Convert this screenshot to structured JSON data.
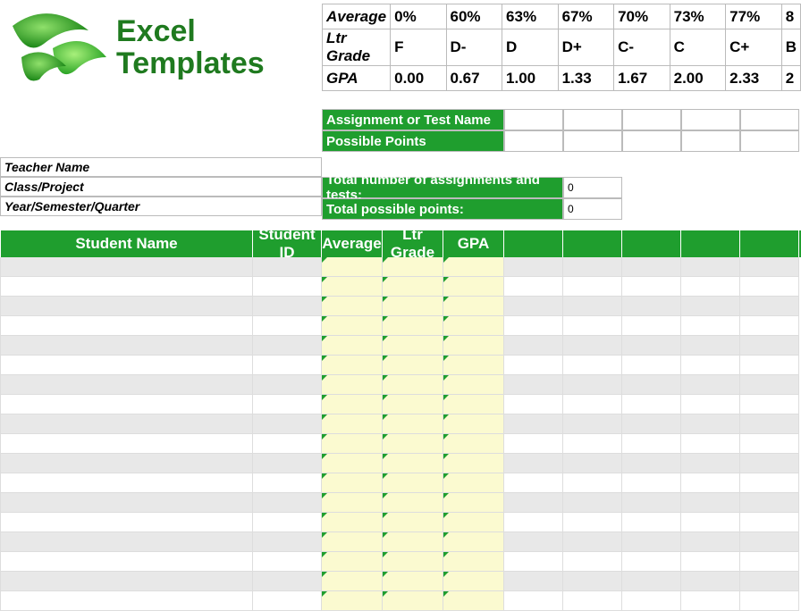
{
  "logo": {
    "line1": "Excel",
    "line2": "Templates"
  },
  "scale": {
    "rows": [
      {
        "label": "Average",
        "vals": [
          "0%",
          "60%",
          "63%",
          "67%",
          "70%",
          "73%",
          "77%",
          "8"
        ]
      },
      {
        "label": "Ltr Grade",
        "vals": [
          "F",
          "D-",
          "D",
          "D+",
          "C-",
          "C",
          "C+",
          "B"
        ]
      },
      {
        "label": "GPA",
        "vals": [
          "0.00",
          "0.67",
          "1.00",
          "1.33",
          "1.67",
          "2.00",
          "2.33",
          "2"
        ]
      }
    ]
  },
  "mid": {
    "assignment_name_label": "Assignment or Test Name",
    "possible_points_label": "Possible Points",
    "total_assignments_label": "Total number of assignments and tests:",
    "total_assignments_value": "0",
    "total_points_label": "Total possible points:",
    "total_points_value": "0"
  },
  "left": {
    "teacher": "Teacher Name",
    "class": "Class/Project",
    "year": "Year/Semester/Quarter"
  },
  "headers": {
    "student_name": "Student Name",
    "student_id": "Student ID",
    "average": "Average",
    "ltr_grade": "Ltr Grade",
    "gpa": "GPA"
  },
  "grid_rows": 18
}
